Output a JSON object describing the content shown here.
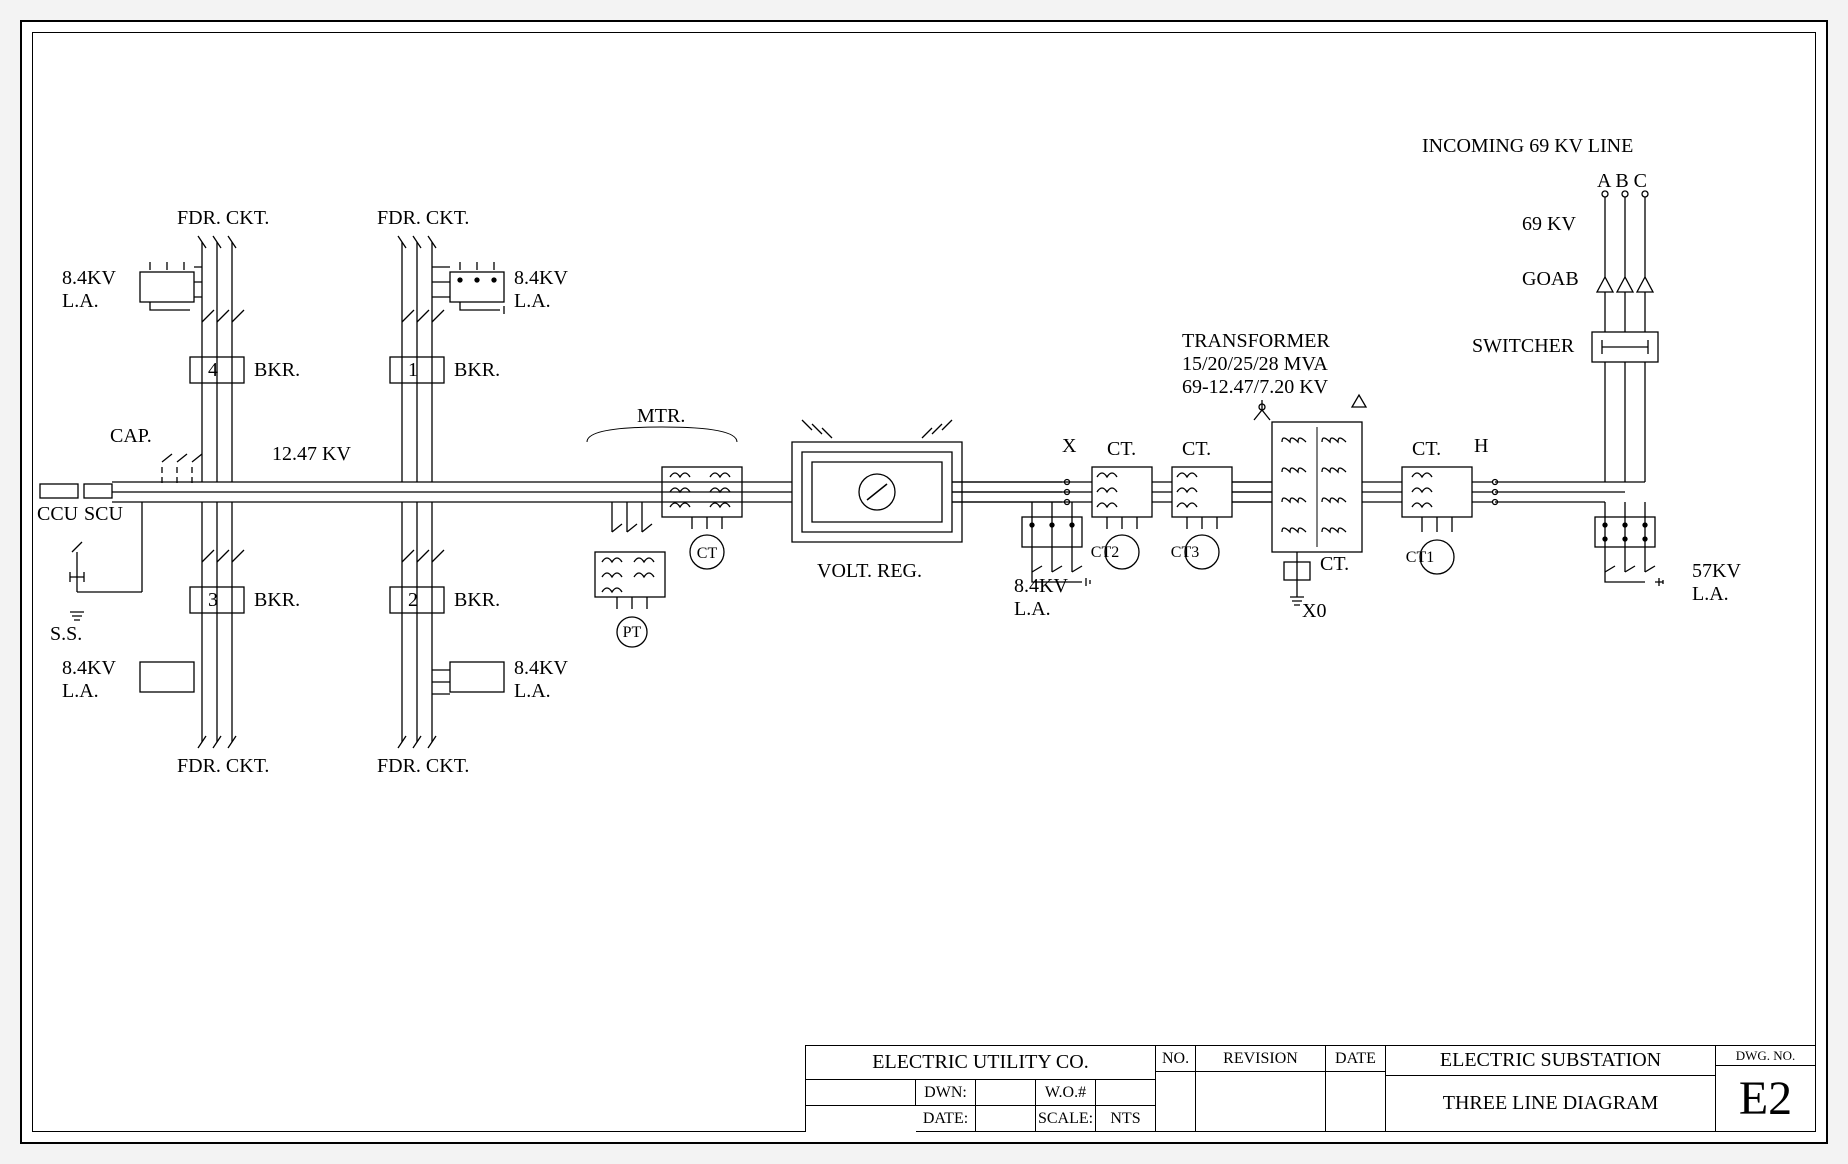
{
  "incoming": {
    "title": "INCOMING 69 KV LINE",
    "phases": "A B C",
    "kv": "69 KV",
    "goab": "GOAB",
    "switcher": "SWITCHER"
  },
  "xfmr": {
    "t1": "TRANSFORMER",
    "t2": "15/20/25/28 MVA",
    "t3": "69-12.47/7.20 KV",
    "x0": "X0",
    "x": "X",
    "h": "H",
    "ct": "CT.",
    "ct1": "CT1",
    "ct2": "CT2",
    "ct3": "CT3"
  },
  "la": {
    "hv": "57KV",
    "hv2": "L.A.",
    "lv": "8.4KV",
    "lv2": "L.A."
  },
  "bus": {
    "kv": "12.47 KV"
  },
  "mtr": {
    "label": "MTR.",
    "ct": "CT",
    "pt": "PT",
    "vr": "VOLT. REG."
  },
  "fdr": {
    "label": "FDR. CKT.",
    "bkr": "BKR.",
    "n1": "1",
    "n2": "2",
    "n3": "3",
    "n4": "4"
  },
  "left": {
    "cap": "CAP.",
    "ccu": "CCU",
    "scu": "SCU",
    "ss": "S.S."
  },
  "tb": {
    "company": "ELECTRIC UTILITY CO.",
    "dwn": "DWN:",
    "date": "DATE:",
    "wo": "W.O.#",
    "scale": "SCALE:",
    "nts": "NTS",
    "no": "NO.",
    "rev": "REVISION",
    "dt": "DATE",
    "t1": "ELECTRIC SUBSTATION",
    "t2": "THREE LINE DIAGRAM",
    "dno": "DWG. NO.",
    "e2": "E2"
  }
}
